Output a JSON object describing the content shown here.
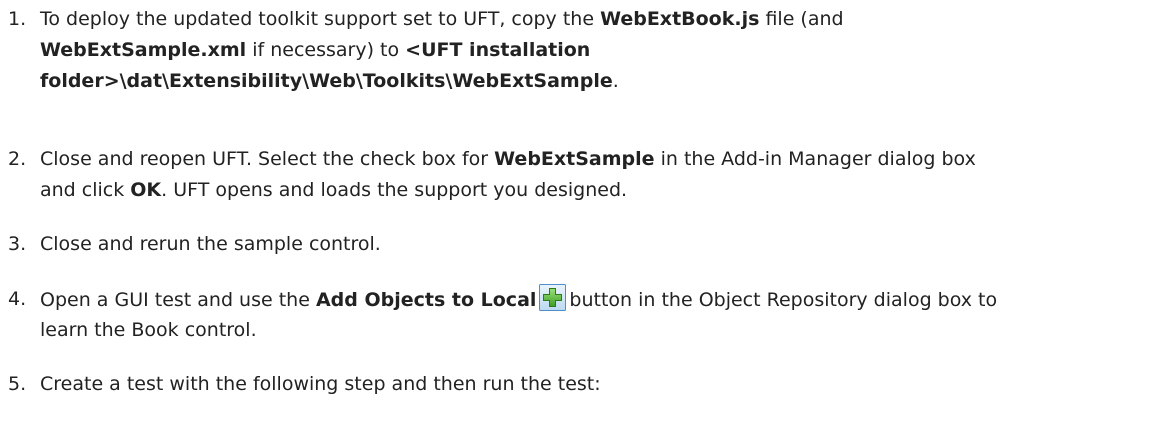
{
  "steps": [
    {
      "number": "1.",
      "lines": [
        {
          "pre": "To deploy the updated toolkit support set to UFT, copy the ",
          "bold": "WebExtBook.js",
          "post": " file (and"
        },
        {
          "bold": "WebExtSample.xml",
          "mid": " if necessary) to ",
          "bold2": "<UFT installation"
        },
        {
          "bold": "folder>\\dat\\Extensibility\\Web\\Toolkits\\WebExtSample",
          "post": "."
        }
      ]
    },
    {
      "number": "2.",
      "lines": [
        {
          "pre": "Close and reopen UFT. Select the check box for ",
          "bold": "WebExtSample",
          "post": " in the Add-in Manager dialog box"
        },
        {
          "pre": "and click ",
          "bold": "OK",
          "post": ". UFT opens and loads the support you designed."
        }
      ]
    },
    {
      "number": "3.",
      "lines": [
        {
          "pre": "Close and rerun the sample control."
        }
      ]
    },
    {
      "number": "4.",
      "lines": [
        {
          "pre": "Open a GUI test and use the ",
          "bold": "Add Objects to Local",
          "icon": "add-objects-plus-icon",
          "post": "button in the Object Repository dialog box to"
        },
        {
          "pre": "learn the Book control."
        }
      ]
    },
    {
      "number": "5.",
      "lines": [
        {
          "pre": "Create a test with the following step and then run the test:"
        }
      ]
    }
  ],
  "colors": {
    "text": "#222222",
    "icon_border": "#4f8fc9",
    "icon_plus": "#5cb83a"
  }
}
